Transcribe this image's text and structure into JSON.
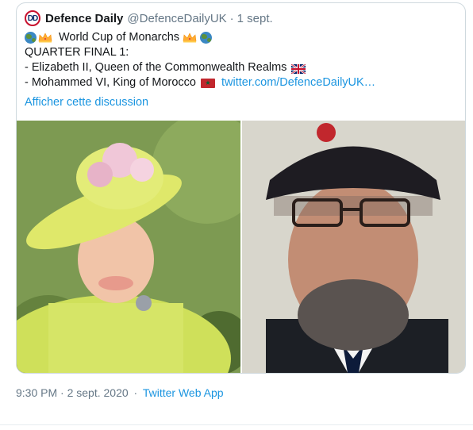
{
  "tweet": {
    "display_name": "Defence Daily",
    "handle": "@DefenceDailyUK",
    "separator": "·",
    "date": "1 sept.",
    "logo_letters": "DD",
    "title_text": "World Cup of Monarchs",
    "line2": "QUARTER FINAL 1:",
    "line3": "- Elizabeth II, Queen of the Commonwealth Realms",
    "line4": "- Mohammed VI, King of Morocco",
    "link_text": "twitter.com/DefenceDailyUK…",
    "thread_link": "Afficher cette discussion",
    "emoji_icons": [
      "globe-icon",
      "crown-icon",
      "uk-flag-icon",
      "morocco-flag-icon"
    ]
  },
  "media": {
    "images": [
      "queen-elizabeth-photo",
      "king-mohammed-photo"
    ]
  },
  "footer": {
    "timestamp": "9:30 PM · 2 sept. 2020",
    "separator": "·",
    "app": "Twitter Web App"
  },
  "colors": {
    "link": "#1b95e0",
    "muted": "#657786",
    "text": "#14171a",
    "border": "#cfd9de"
  }
}
